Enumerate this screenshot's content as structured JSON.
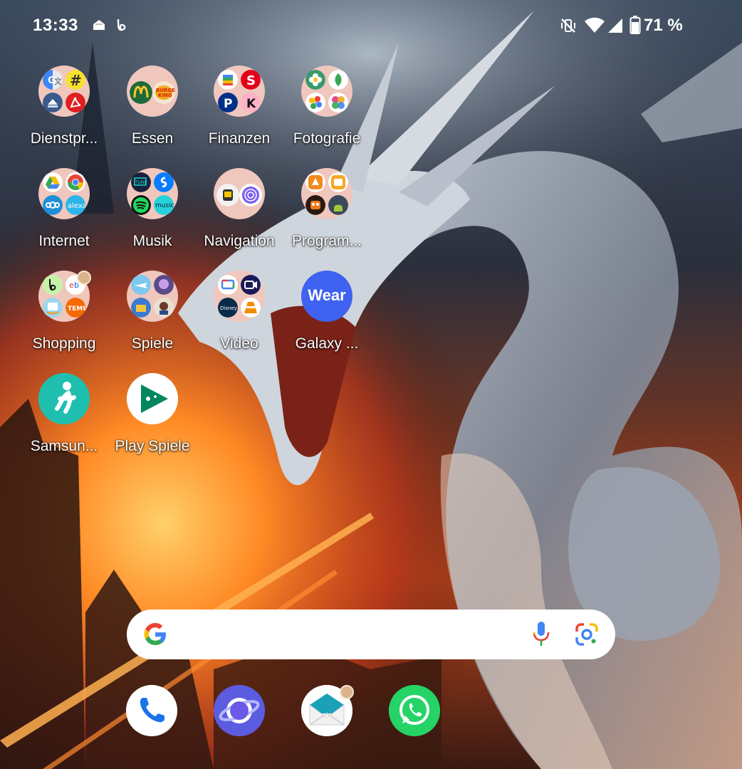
{
  "status_bar": {
    "time": "13:33",
    "battery": "71 %",
    "icons": [
      "inbox-icon",
      "shopping-app-icon",
      "vibrate-off-icon",
      "wifi-icon",
      "signal-icon",
      "battery-icon"
    ]
  },
  "home": {
    "folders": [
      {
        "label": "Dienstpr...",
        "apps": [
          "google-translate-icon",
          "hashtag-app-icon",
          "scanner-app-icon",
          "acrobat-reader-icon"
        ]
      },
      {
        "label": "Essen",
        "apps": [
          "mcdonalds-icon",
          "burger-king-icon"
        ]
      },
      {
        "label": "Finanzen",
        "apps": [
          "google-wallet-icon",
          "sparkasse-icon",
          "paypal-icon",
          "klarna-icon"
        ]
      },
      {
        "label": "Fotografie",
        "apps": [
          "flower-app-icon",
          "snapseed-icon",
          "google-photos-icon",
          "gallery-icon"
        ]
      },
      {
        "label": "Internet",
        "apps": [
          "google-drive-icon",
          "chrome-icon",
          "nextcloud-icon",
          "alexa-icon"
        ]
      },
      {
        "label": "Musik",
        "apps": [
          "tunein-icon",
          "shazam-icon",
          "spotify-icon",
          "amazon-music-icon"
        ]
      },
      {
        "label": "Navigation",
        "apps": [
          "maps-app-icon",
          "airtag-app-icon"
        ]
      },
      {
        "label": "Program...",
        "apps": [
          "app-orange-icon",
          "app-yellow-icon",
          "robot-app-icon",
          "android-app-icon"
        ]
      },
      {
        "label": "Shopping",
        "apps": [
          "shopping-app-icon",
          "ebay-icon",
          "amazon-icon",
          "temu-icon"
        ]
      },
      {
        "label": "Spiele",
        "apps": [
          "game-plane-icon",
          "game-purple-icon",
          "game-blue-icon",
          "game-char-icon"
        ]
      },
      {
        "label": "Video",
        "apps": [
          "google-tv-icon",
          "video-editor-icon",
          "disney-plus-icon",
          "vlc-icon"
        ]
      }
    ],
    "apps": [
      {
        "label": "Galaxy ...",
        "icon": "galaxy-wearable-icon",
        "text": "Wear"
      },
      {
        "label": "Samsun...",
        "icon": "samsung-health-icon"
      },
      {
        "label": "Play Spiele",
        "icon": "play-games-icon"
      }
    ]
  },
  "search_bar": {
    "icons": [
      "google-g-icon",
      "microphone-icon",
      "google-lens-icon"
    ]
  },
  "dock": {
    "apps": [
      "phone-icon",
      "samsung-internet-icon",
      "email-icon",
      "whatsapp-icon"
    ]
  }
}
